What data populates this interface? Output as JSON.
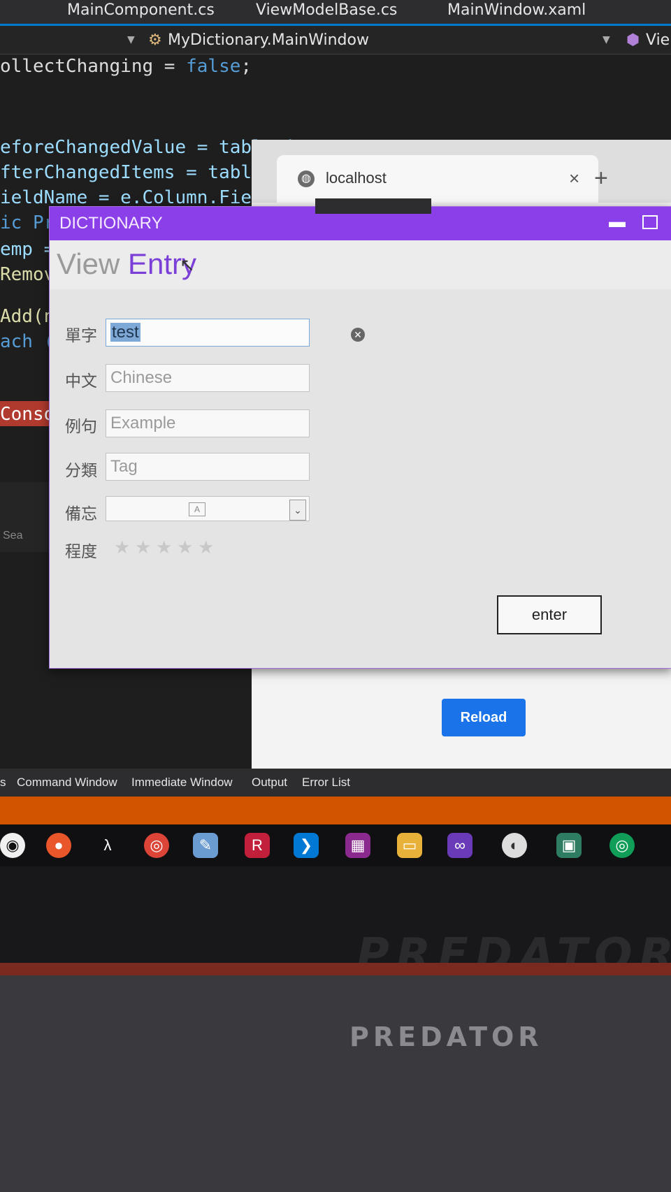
{
  "ide": {
    "tabs": [
      "MainComponent.cs",
      "ViewModelBase.cs",
      "MainWindow.xaml"
    ],
    "nav_class": "MyDictionary.MainWindow",
    "nav_right": "Vie",
    "code": {
      "line1a": "ollectChanging = ",
      "line1b": "false",
      "line1c": ";",
      "line2": "eforeChangedValue = tableVi",
      "line3": "fterChangedItems = tableVie",
      "line4": "ieldName = e.Column.FieldNa",
      "line5": "ic Pri",
      "line6": "emp =",
      "line7": "Remove",
      "line8": "Add(ne",
      "line9": "ach (va",
      "line10": "Console",
      "line11": "Sea"
    },
    "panel_tabs": [
      "s",
      "Command Window",
      "Immediate Window",
      "Output",
      "Error List"
    ]
  },
  "browser": {
    "tab_title": "localhost",
    "close_glyph": "×",
    "new_tab_glyph": "+",
    "reload_label": "Reload"
  },
  "app": {
    "title": "DICTIONARY",
    "menu": {
      "view": "View",
      "entry": "Entry"
    },
    "fields": {
      "word_label": "單字",
      "word_value": "test",
      "chinese_label": "中文",
      "chinese_placeholder": "Chinese",
      "example_label": "例句",
      "example_placeholder": "Example",
      "tag_label": "分類",
      "tag_placeholder": "Tag",
      "memo_label": "備忘",
      "level_label": "程度"
    },
    "rating": {
      "max": 5,
      "value": 0
    },
    "enter_label": "enter"
  },
  "device": {
    "brand": "PREDATOR"
  },
  "colors": {
    "accent": "#8b3fe8",
    "reload": "#1a73e8",
    "taskbar_strip": "#d35400"
  }
}
